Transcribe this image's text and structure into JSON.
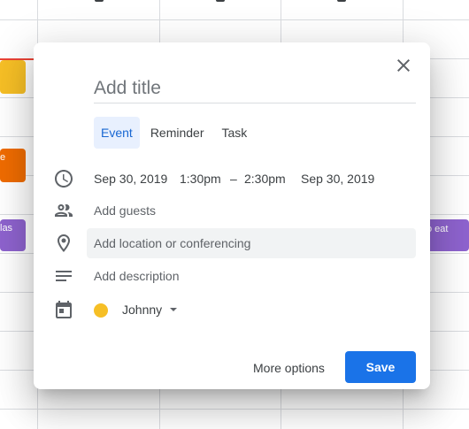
{
  "background": {
    "event_left_orange": "e",
    "event_left_purple": "las",
    "event_right_purple": "o eat",
    "colors": {
      "yellow": "#f6bf26",
      "orange": "#ef6c00",
      "purple": "#8e63ce",
      "now_line": "#ea4335"
    }
  },
  "dialog": {
    "title_placeholder": "Add title",
    "tabs": [
      {
        "label": "Event",
        "active": true
      },
      {
        "label": "Reminder",
        "active": false
      },
      {
        "label": "Task",
        "active": false
      }
    ],
    "datetime": {
      "start_date": "Sep 30, 2019",
      "start_time": "1:30pm",
      "separator": "–",
      "end_time": "2:30pm",
      "end_date": "Sep 30, 2019"
    },
    "guests_placeholder": "Add guests",
    "location_placeholder": "Add location or conferencing",
    "description_placeholder": "Add description",
    "calendar": {
      "name": "Johnny",
      "color": "#f6bf26"
    },
    "more_options_label": "More options",
    "save_label": "Save",
    "accent_color": "#1a73e8"
  }
}
